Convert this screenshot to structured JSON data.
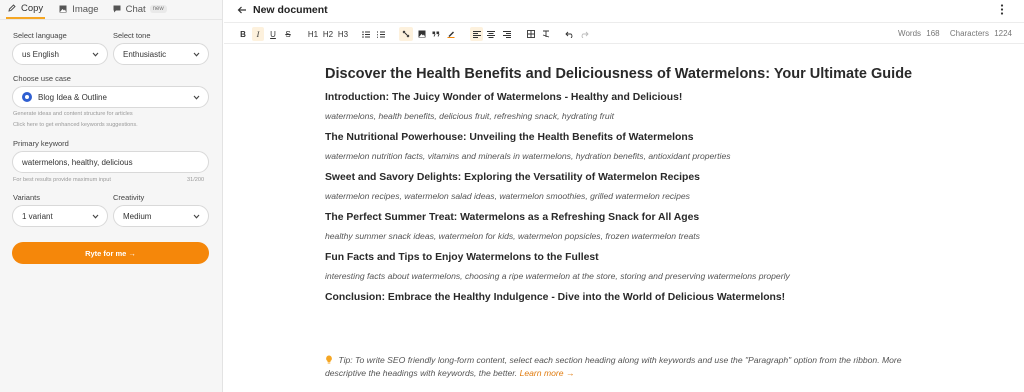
{
  "tabs": [
    {
      "label": "Copy",
      "icon": "pen-icon"
    },
    {
      "label": "Image",
      "icon": "image-icon"
    },
    {
      "label": "Chat",
      "icon": "chat-icon",
      "badge": "new"
    }
  ],
  "form": {
    "language_label": "Select language",
    "language_value": "us English",
    "tone_label": "Select tone",
    "tone_value": "Enthusiastic",
    "use_case_label": "Choose use case",
    "use_case_value": "Blog Idea & Outline",
    "use_case_hint1": "Generate ideas and content structure for articles",
    "use_case_hint2": "Click here to get enhanced keywords suggestions.",
    "keyword_label": "Primary keyword",
    "keyword_value": "watermelons, healthy, delicious",
    "keyword_hint": "For best results provide maximum input",
    "keyword_count": "31/200",
    "variants_label": "Variants",
    "variants_value": "1 variant",
    "creativity_label": "Creativity",
    "creativity_value": "Medium",
    "submit_label": "Ryte for me →"
  },
  "editor": {
    "title": "New document",
    "toolbar": {
      "bold": "B",
      "italic": "I",
      "underline": "U",
      "strike": "S",
      "h1": "H1",
      "h2": "H2",
      "h3": "H3"
    },
    "words_label": "Words",
    "words_value": "168",
    "chars_label": "Characters",
    "chars_value": "1224"
  },
  "document": {
    "title": "Discover the Health Benefits and Deliciousness of Watermelons: Your Ultimate Guide",
    "sections": [
      {
        "heading": "Introduction: The Juicy Wonder of Watermelons - Healthy and Delicious!",
        "keywords": "watermelons, health benefits, delicious fruit, refreshing snack, hydrating fruit"
      },
      {
        "heading": "The Nutritional Powerhouse: Unveiling the Health Benefits of Watermelons",
        "keywords": "watermelon nutrition facts, vitamins and minerals in watermelons, hydration benefits, antioxidant properties"
      },
      {
        "heading": "Sweet and Savory Delights: Exploring the Versatility of Watermelon Recipes",
        "keywords": "watermelon recipes, watermelon salad ideas, watermelon smoothies, grilled watermelon recipes"
      },
      {
        "heading": "The Perfect Summer Treat: Watermelons as a Refreshing Snack for All Ages",
        "keywords": "healthy summer snack ideas, watermelon for kids, watermelon popsicles, frozen watermelon treats"
      },
      {
        "heading": "Fun Facts and Tips to Enjoy Watermelons to the Fullest",
        "keywords": "interesting facts about watermelons, choosing a ripe watermelon at the store, storing and preserving watermelons properly"
      },
      {
        "heading": "Conclusion: Embrace the Healthy Indulgence - Dive into the World of Delicious Watermelons!",
        "keywords": ""
      }
    ],
    "tip_text": "Tip: To write SEO friendly long-form content, select each section heading along with keywords and use the \"Paragraph\" option from the ribbon. More descriptive the headings with keywords, the better.",
    "tip_link": "Learn more →"
  },
  "colors": {
    "accent": "#f5870a",
    "use_case_icon": "#2f5fd1"
  }
}
